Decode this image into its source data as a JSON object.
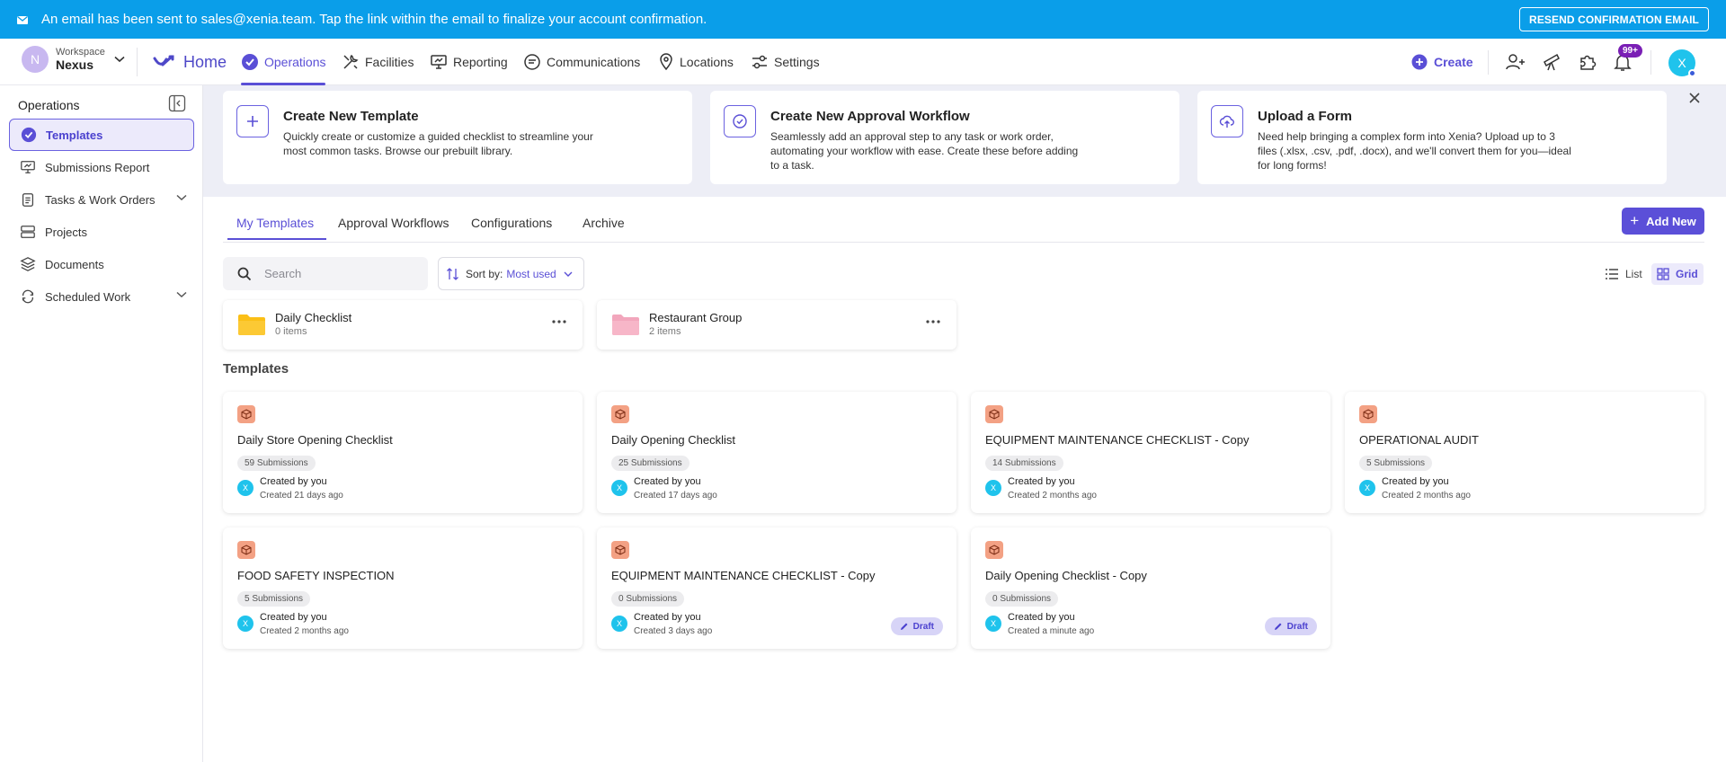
{
  "banner": {
    "message": "An email has been sent to sales@xenia.team. Tap the link within the email to finalize your account confirmation.",
    "resend_label": "RESEND CONFIRMATION EMAIL"
  },
  "workspace": {
    "avatar": "N",
    "label": "Workspace",
    "name": "Nexus"
  },
  "nav": {
    "home": "Home",
    "operations": "Operations",
    "facilities": "Facilities",
    "reporting": "Reporting",
    "communications": "Communications",
    "locations": "Locations",
    "settings": "Settings",
    "create": "Create",
    "notifications_badge": "99+",
    "user_avatar": "X"
  },
  "sidebar": {
    "title": "Operations",
    "items": [
      {
        "label": "Templates",
        "icon": "check-circle-icon"
      },
      {
        "label": "Submissions Report",
        "icon": "report-icon"
      },
      {
        "label": "Tasks & Work Orders",
        "icon": "clipboard-icon"
      },
      {
        "label": "Projects",
        "icon": "projects-icon"
      },
      {
        "label": "Documents",
        "icon": "layers-icon"
      },
      {
        "label": "Scheduled Work",
        "icon": "recurring-icon"
      }
    ]
  },
  "help_cards": [
    {
      "title": "Create New Template",
      "desc": "Quickly create or customize a guided checklist to streamline your most common tasks. Browse our prebuilt library."
    },
    {
      "title": "Create New Approval Workflow",
      "desc": "Seamlessly add an approval step to any task or work order, automating your workflow with ease. Create these before adding to a task."
    },
    {
      "title": "Upload a Form",
      "desc": "Need help bringing a complex form into Xenia? Upload up to 3 files (.xlsx, .csv, .pdf, .docx), and we'll convert them for you—ideal for long forms!"
    }
  ],
  "tabs": [
    "My Templates",
    "Approval Workflows",
    "Configurations",
    "Archive"
  ],
  "add_new": "Add New",
  "search": {
    "placeholder": "Search"
  },
  "sort": {
    "label": "Sort by:",
    "value": "Most used"
  },
  "view": {
    "list": "List",
    "grid": "Grid"
  },
  "folders": [
    {
      "name": "Daily Checklist",
      "count": "0 items",
      "color": "#fbbf16"
    },
    {
      "name": "Restaurant Group",
      "count": "2 items",
      "color": "#f7b6c8"
    }
  ],
  "section_title": "Templates",
  "templates": [
    {
      "name": "Daily Store Opening Checklist",
      "subs": "59 Submissions",
      "by": "Created by you",
      "ago": "Created 21 days ago",
      "draft": ""
    },
    {
      "name": "Daily Opening Checklist",
      "subs": "25 Submissions",
      "by": "Created by you",
      "ago": "Created 17 days ago",
      "draft": ""
    },
    {
      "name": "EQUIPMENT MAINTENANCE CHECKLIST - Copy",
      "subs": "14 Submissions",
      "by": "Created by you",
      "ago": "Created 2 months ago",
      "draft": ""
    },
    {
      "name": "OPERATIONAL AUDIT",
      "subs": "5 Submissions",
      "by": "Created by you",
      "ago": "Created 2 months ago",
      "draft": ""
    },
    {
      "name": "FOOD SAFETY INSPECTION",
      "subs": "5 Submissions",
      "by": "Created by you",
      "ago": "Created 2 months ago",
      "draft": ""
    },
    {
      "name": "EQUIPMENT MAINTENANCE CHECKLIST - Copy",
      "subs": "0 Submissions",
      "by": "Created by you",
      "ago": "Created 3 days ago",
      "draft": "Draft"
    },
    {
      "name": "Daily Opening Checklist - Copy",
      "subs": "0 Submissions",
      "by": "Created by you",
      "ago": "Created a minute ago",
      "draft": "Draft"
    }
  ],
  "creator_avatar": "X",
  "colors": {
    "brand": "#5a4fd6",
    "banner": "#0a9ee9",
    "template_icon": "#f3a184",
    "avatar": "#1fc3ec"
  }
}
